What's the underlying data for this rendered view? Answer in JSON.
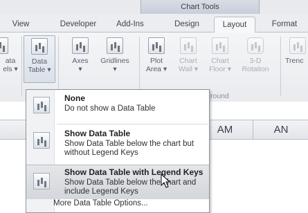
{
  "title_bar": {
    "context_group": "Chart Tools"
  },
  "tabs": [
    {
      "label": "View"
    },
    {
      "label": "Developer"
    },
    {
      "label": "Add-Ins"
    },
    {
      "label": "Design"
    },
    {
      "label": "Layout",
      "active": true
    },
    {
      "label": "Format"
    }
  ],
  "ribbon": {
    "buttons": [
      {
        "label1": "ata",
        "label2": "els ▾",
        "icon": "data-labels-icon"
      },
      {
        "label1": "Data",
        "label2": "Table ▾",
        "icon": "data-table-icon"
      },
      {
        "label1": "Axes",
        "label2": "▾",
        "icon": "axes-icon"
      },
      {
        "label1": "Gridlines",
        "label2": "▾",
        "icon": "gridlines-icon"
      },
      {
        "label1": "Plot",
        "label2": "Area ▾",
        "icon": "plot-area-icon"
      },
      {
        "label1": "Chart",
        "label2": "Wall ▾",
        "icon": "chart-wall-icon"
      },
      {
        "label1": "Chart",
        "label2": "Floor ▾",
        "icon": "chart-floor-icon"
      },
      {
        "label1": "3-D",
        "label2": "Rotation",
        "icon": "3d-rotation-icon"
      },
      {
        "label1": "Trenc",
        "label2": "",
        "icon": "trendline-icon"
      }
    ],
    "group_label_partial": "round"
  },
  "columns": [
    "AM",
    "AN"
  ],
  "menu": {
    "items": [
      {
        "title": "None",
        "description": "Do not show a Data Table"
      },
      {
        "title": "Show Data Table",
        "description": "Show Data Table below the chart but without Legend Keys"
      },
      {
        "title": "Show Data Table with Legend Keys",
        "description": "Show Data Table below the chart and include Legend Keys",
        "highlighted": true
      }
    ],
    "more": "More Data Table Options..."
  },
  "colors": {
    "menu_border": "#8e949c",
    "highlight": "#d4d7db",
    "ribbon_bg": "#eceef1"
  }
}
